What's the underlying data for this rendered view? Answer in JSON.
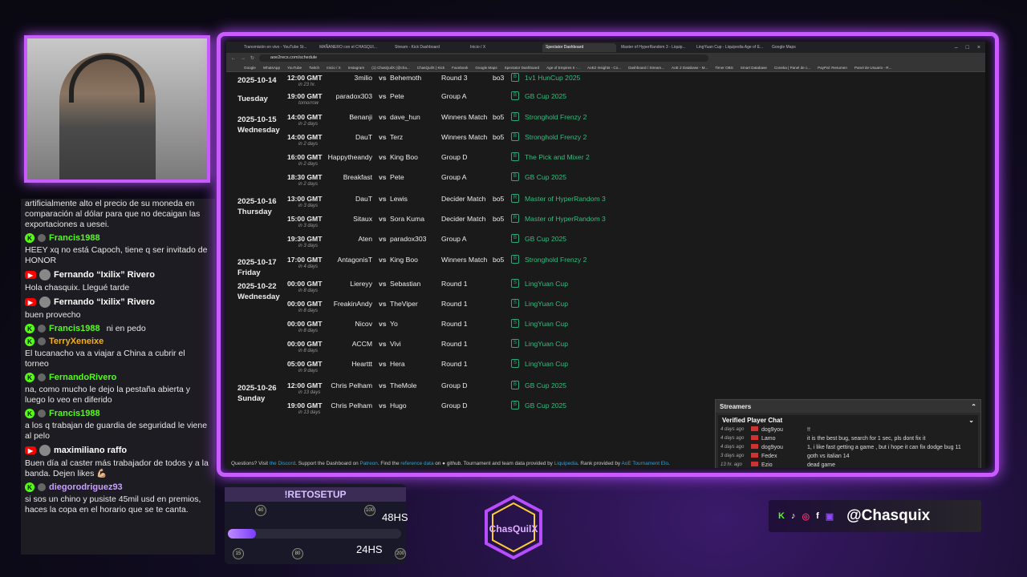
{
  "browser": {
    "tabs": [
      "Transmisión en vivo - YouTube St...",
      "MAÑANERO con el CHASQUI...",
      "Stream - Kick Dashboard",
      "Inicio / X",
      "Spectator Dashboard",
      "Master of HyperRandom 3 - Liquip...",
      "LingYuan Cup - Liquipedia Age of E...",
      "Google Maps"
    ],
    "url": "aoe2recs.com/schedule",
    "bookmarks": [
      "Google",
      "WhatsApp",
      "YouTube",
      "Twitch",
      "Inicio / X",
      "Instagram",
      "(1) ChasQuilX (@cha...",
      "ChasQuilX | Kick",
      "Facebook",
      "Google Maps",
      "Spectator Dashboard",
      "Age of Empires II -...",
      "AoE2 Insights - Co...",
      "Dashboard / Stream...",
      "AoE 2 Database - M...",
      "Timer OBS",
      "Smart Database",
      "Coneka | Panel de c...",
      "PayPal: Resumen",
      "Panel de Usuario - R..."
    ]
  },
  "schedule": [
    {
      "date": "2025-10-14",
      "day": "",
      "time": "12:00 GMT",
      "rel": "in 23 hr.",
      "p1": "3milio",
      "p2": "Behemoth",
      "stage": "Round 3",
      "bo": "bo3",
      "tourn": "1v1 HunCup 2025",
      "logo": "B"
    },
    {
      "date": "",
      "day": "Tuesday",
      "time": "19:00 GMT",
      "rel": "tomorrow",
      "p1": "paradox303",
      "p2": "Pete",
      "stage": "Group A",
      "bo": "",
      "tourn": "GB Cup 2025",
      "logo": "B"
    },
    {
      "date": "2025-10-15",
      "day": "Wednesday",
      "time": "14:00 GMT",
      "rel": "in 2 days",
      "p1": "Benanji",
      "p2": "dave_hun",
      "stage": "Winners Match",
      "bo": "bo5",
      "tourn": "Stronghold Frenzy 2",
      "logo": "B"
    },
    {
      "date": "",
      "day": "",
      "time": "14:00 GMT",
      "rel": "in 2 days",
      "p1": "DauT",
      "p2": "Terz",
      "stage": "Winners Match",
      "bo": "bo5",
      "tourn": "Stronghold Frenzy 2",
      "logo": "B"
    },
    {
      "date": "",
      "day": "",
      "time": "16:00 GMT",
      "rel": "in 2 days",
      "p1": "Happytheandy",
      "p2": "King Boo",
      "stage": "Group D",
      "bo": "",
      "tourn": "The Pick and Mixer 2",
      "logo": "B"
    },
    {
      "date": "",
      "day": "",
      "time": "18:30 GMT",
      "rel": "in 2 days",
      "p1": "Breakfast",
      "p2": "Pete",
      "stage": "Group A",
      "bo": "",
      "tourn": "GB Cup 2025",
      "logo": "B"
    },
    {
      "date": "2025-10-16",
      "day": "Thursday",
      "time": "13:00 GMT",
      "rel": "in 3 days",
      "p1": "DauT",
      "p2": "Lewis",
      "stage": "Decider Match",
      "bo": "bo5",
      "tourn": "Master of HyperRandom 3",
      "logo": "R"
    },
    {
      "date": "",
      "day": "",
      "time": "15:00 GMT",
      "rel": "in 3 days",
      "p1": "Sitaux",
      "p2": "Sora Kuma",
      "stage": "Decider Match",
      "bo": "bo5",
      "tourn": "Master of HyperRandom 3",
      "logo": "R"
    },
    {
      "date": "",
      "day": "",
      "time": "19:30 GMT",
      "rel": "in 3 days",
      "p1": "Aten",
      "p2": "paradox303",
      "stage": "Group A",
      "bo": "",
      "tourn": "GB Cup 2025",
      "logo": "B"
    },
    {
      "date": "2025-10-17",
      "day": "Friday",
      "time": "17:00 GMT",
      "rel": "in 4 days",
      "p1": "AntagonisT",
      "p2": "King Boo",
      "stage": "Winners Match",
      "bo": "bo5",
      "tourn": "Stronghold Frenzy 2",
      "logo": "B"
    },
    {
      "date": "2025-10-22",
      "day": "Wednesday",
      "time": "00:00 GMT",
      "rel": "in 8 days",
      "p1": "Liereyy",
      "p2": "Sebastian",
      "stage": "Round 1",
      "bo": "",
      "tourn": "LingYuan Cup",
      "logo": "S"
    },
    {
      "date": "",
      "day": "",
      "time": "00:00 GMT",
      "rel": "in 8 days",
      "p1": "FreakinAndy",
      "p2": "TheViper",
      "stage": "Round 1",
      "bo": "",
      "tourn": "LingYuan Cup",
      "logo": "S"
    },
    {
      "date": "",
      "day": "",
      "time": "00:00 GMT",
      "rel": "in 8 days",
      "p1": "Nicov",
      "p2": "Yo",
      "stage": "Round 1",
      "bo": "",
      "tourn": "LingYuan Cup",
      "logo": "S"
    },
    {
      "date": "",
      "day": "",
      "time": "00:00 GMT",
      "rel": "in 8 days",
      "p1": "ACCM",
      "p2": "Vivi",
      "stage": "Round 1",
      "bo": "",
      "tourn": "LingYuan Cup",
      "logo": "S"
    },
    {
      "date": "",
      "day": "",
      "time": "05:00 GMT",
      "rel": "in 9 days",
      "p1": "Hearttt",
      "p2": "Hera",
      "stage": "Round 1",
      "bo": "",
      "tourn": "LingYuan Cup",
      "logo": "S"
    },
    {
      "date": "2025-10-26",
      "day": "Sunday",
      "time": "12:00 GMT",
      "rel": "in 13 days",
      "p1": "Chris Pelham",
      "p2": "TheMole",
      "stage": "Group D",
      "bo": "",
      "tourn": "GB Cup 2025",
      "logo": "B"
    },
    {
      "date": "",
      "day": "",
      "time": "19:00 GMT",
      "rel": "in 13 days",
      "p1": "Chris Pelham",
      "p2": "Hugo",
      "stage": "Group D",
      "bo": "",
      "tourn": "GB Cup 2025",
      "logo": "B"
    }
  ],
  "footer": {
    "t1": "Questions? Visit ",
    "l1": "the Discord",
    "t2": ". Support the Dashboard on ",
    "l2": "Patreon",
    "t3": ". Find the ",
    "l3": "reference data",
    "t4": " on ",
    "t5": " github. Tournament and team data provided by ",
    "l4": "Liquipedia",
    "t6": ". Rank provided by ",
    "l5": "AoE Tournament Elo",
    "t7": "."
  },
  "streamers": {
    "title": "Streamers",
    "chat_title": "Verified Player Chat",
    "rows": [
      {
        "ago": "4 days ago",
        "who": "dog9you",
        "txt": "!!"
      },
      {
        "ago": "4 days ago",
        "who": "Lamo",
        "txt": "it is the best bug, search for 1 sec, pls dont fix it"
      },
      {
        "ago": "4 days ago",
        "who": "dog9you",
        "txt": "1, i like fast getting a game , but i hope it can fix dodge bug 11"
      },
      {
        "ago": "3 days ago",
        "who": "Fedex",
        "txt": "goth vs italian 14"
      },
      {
        "ago": "13 hr. ago",
        "who": "Ezio",
        "txt": "dead game"
      }
    ]
  },
  "chat": [
    {
      "user": "",
      "platform": "",
      "text": "artificialmente alto el precio de su moneda en comparación al dólar para que no decaigan las exportaciones a uesei."
    },
    {
      "user": "Francis1988",
      "platform": "kick",
      "color": "#53fc18",
      "text": "HEEY xq no está Capoch, tiene q ser invitado de HONOR"
    },
    {
      "user": "Fernando “Ixilix” Rivero",
      "platform": "yt",
      "color": "#ffffff",
      "text": "Hola chasquix. Llegué tarde"
    },
    {
      "user": "Fernando “Ixilix” Rivero",
      "platform": "yt",
      "color": "#ffffff",
      "text": "buen provecho"
    },
    {
      "user": "Francis1988",
      "platform": "kick",
      "color": "#53fc18",
      "inline": "ni en pedo",
      "text": ""
    },
    {
      "user": "TerryXeneixe",
      "platform": "kick",
      "color": "#f0b020",
      "text": "El tucanacho va a viajar a China a cubrir el torneo"
    },
    {
      "user": "FernandoRivero",
      "platform": "kick",
      "color": "#53fc18",
      "text": "na, como mucho le dejo la pestaña abierta y luego lo veo en diferido"
    },
    {
      "user": "Francis1988",
      "platform": "kick",
      "color": "#53fc18",
      "text": "a los q trabajan de guardia de seguridad le viene al pelo"
    },
    {
      "user": "maximiliano raffo",
      "platform": "yt",
      "color": "#ffffff",
      "text": "Buen día al caster más trabajador de todos y a la banda. Dejen likes 💪🏼"
    },
    {
      "user": "diegorodriguez93",
      "platform": "kick",
      "color": "#c8a0ff",
      "text": "si sos un chino y pusiste 45mil usd en premios, haces la copa en el horario que se te canta."
    }
  ],
  "overlay": {
    "setup_title": "!RETOSETUP",
    "hs48": "48HS",
    "hs24": "24HS",
    "progress": 0.16,
    "icon_labels": [
      "40",
      "100",
      "15",
      "80",
      "200"
    ],
    "logo_text": "ChasQuilX",
    "handle": "@Chasquix"
  }
}
